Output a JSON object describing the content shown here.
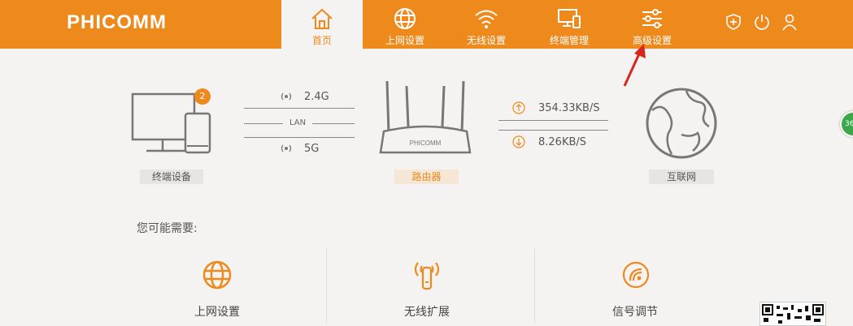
{
  "brand": {
    "logo_text": "PHICOMM"
  },
  "nav": {
    "items": [
      {
        "label": "首页",
        "icon": "home-icon",
        "active": true
      },
      {
        "label": "上网设置",
        "icon": "globe-icon"
      },
      {
        "label": "无线设置",
        "icon": "wifi-icon"
      },
      {
        "label": "终端管理",
        "icon": "devices-icon"
      },
      {
        "label": "高级设置",
        "icon": "sliders-icon"
      }
    ]
  },
  "header_icons": [
    "shield-icon",
    "power-icon",
    "user-icon"
  ],
  "status": {
    "terminal_label": "终端设备",
    "terminal_count": "2",
    "band_24": "2.4G",
    "lan_label": "LAN",
    "band_5": "5G",
    "router_brand": "PHICOMM",
    "router_label": "路由器",
    "upload_speed": "354.33KB/S",
    "download_speed": "8.26KB/S",
    "internet_label": "互联网"
  },
  "quick": {
    "title": "您可能需要:",
    "items": [
      {
        "label": "上网设置",
        "icon": "globe-icon"
      },
      {
        "label": "无线扩展",
        "icon": "wireless-extend-icon"
      },
      {
        "label": "信号调节",
        "icon": "signal-adjust-icon"
      }
    ]
  },
  "side_widget": {
    "text": "36"
  },
  "colors": {
    "accent": "#ee8a1c",
    "background": "#f4f3f1",
    "widget_green": "#3aa84a"
  }
}
